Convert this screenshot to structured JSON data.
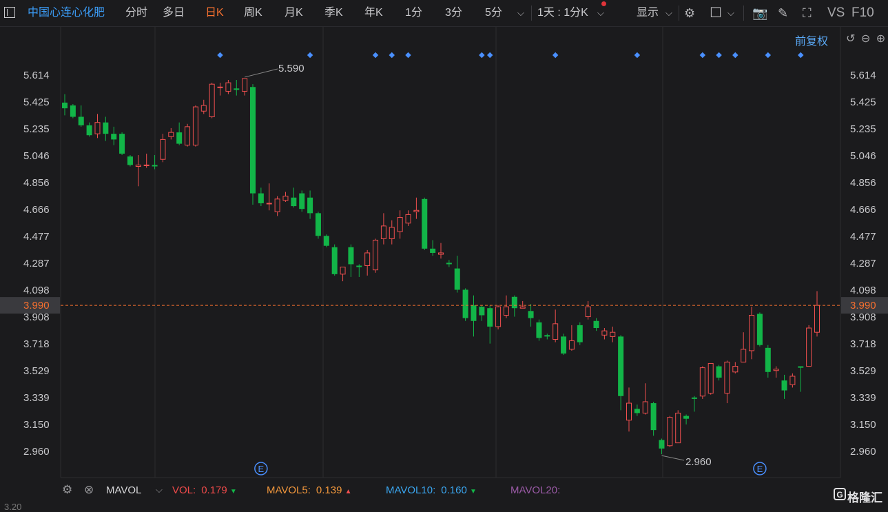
{
  "toolbar": {
    "stock_name": "中国心连心化肥",
    "periods": [
      "分时",
      "多日",
      "日K",
      "周K",
      "月K",
      "季K",
      "年K",
      "1分",
      "3分",
      "5分"
    ],
    "active_period": "日K",
    "interval_select": "1天 : 1分K",
    "display_label": "显示",
    "vs_label": "VS",
    "f10_label": "F10"
  },
  "chart_header": {
    "adjust_label": "前复权"
  },
  "price_axis": {
    "ticks": [
      "5.614",
      "5.425",
      "5.235",
      "5.046",
      "4.856",
      "4.666",
      "4.477",
      "4.287",
      "4.098",
      "3.908",
      "3.718",
      "3.529",
      "3.339",
      "3.150",
      "2.960"
    ],
    "current_price": "3.990",
    "current_price_color": "#f6702f"
  },
  "annotations": {
    "high_label": "5.590",
    "low_label": "2.960",
    "event_marker": "E"
  },
  "indicator": {
    "name": "MAVOL",
    "vol_label": "VOL:",
    "vol_value": "0.179",
    "mavol5_label": "MAVOL5:",
    "mavol5_value": "0.139",
    "mavol10_label": "MAVOL10:",
    "mavol10_value": "0.160",
    "mavol20_label": "MAVOL20:",
    "vol_color": "#ef4a4a",
    "mavol5_color": "#f0963c",
    "mavol10_color": "#3aa6f0",
    "mavol20_color": "#9a5aa6"
  },
  "brand": "格隆汇",
  "bottom_peek": "3.20",
  "colors": {
    "up": "#f04f4f",
    "down": "#12b548",
    "marker": "#4a90ff",
    "grid": "#2c2c30"
  },
  "chart_data": {
    "type": "candlestick",
    "ylim": [
      2.86,
      5.71
    ],
    "candles": [
      [
        5.42,
        5.38,
        5.48,
        5.33
      ],
      [
        5.4,
        5.32,
        5.41,
        5.31
      ],
      [
        5.32,
        5.26,
        5.4,
        5.25
      ],
      [
        5.26,
        5.19,
        5.28,
        5.18
      ],
      [
        5.2,
        5.28,
        5.34,
        5.17
      ],
      [
        5.28,
        5.2,
        5.32,
        5.15
      ],
      [
        5.2,
        5.16,
        5.25,
        5.12
      ],
      [
        5.2,
        5.06,
        5.21,
        5.05
      ],
      [
        5.04,
        4.98,
        5.05,
        4.97
      ],
      [
        4.97,
        4.98,
        5.05,
        4.83
      ],
      [
        4.98,
        4.98,
        5.06,
        4.96
      ],
      [
        4.98,
        4.97,
        5.05,
        4.95
      ],
      [
        5.02,
        5.16,
        5.2,
        5.0
      ],
      [
        5.18,
        5.21,
        5.24,
        5.16
      ],
      [
        5.21,
        5.13,
        5.28,
        5.12
      ],
      [
        5.12,
        5.25,
        5.27,
        5.11
      ],
      [
        5.12,
        5.39,
        5.4,
        5.11
      ],
      [
        5.36,
        5.4,
        5.44,
        5.34
      ],
      [
        5.32,
        5.55,
        5.56,
        5.31
      ],
      [
        5.53,
        5.53,
        5.56,
        5.47
      ],
      [
        5.5,
        5.56,
        5.58,
        5.48
      ],
      [
        5.52,
        5.51,
        5.58,
        5.47
      ],
      [
        5.5,
        5.59,
        5.59,
        5.47
      ],
      [
        5.53,
        4.78,
        5.55,
        4.7
      ],
      [
        4.78,
        4.71,
        4.82,
        4.69
      ],
      [
        4.71,
        4.71,
        4.85,
        4.66
      ],
      [
        4.65,
        4.74,
        4.76,
        4.62
      ],
      [
        4.73,
        4.76,
        4.79,
        4.72
      ],
      [
        4.75,
        4.69,
        4.82,
        4.68
      ],
      [
        4.78,
        4.67,
        4.8,
        4.65
      ],
      [
        4.75,
        4.64,
        4.8,
        4.6
      ],
      [
        4.64,
        4.48,
        4.65,
        4.46
      ],
      [
        4.48,
        4.41,
        4.49,
        4.4
      ],
      [
        4.4,
        4.21,
        4.42,
        4.2
      ],
      [
        4.21,
        4.26,
        4.26,
        4.16
      ],
      [
        4.4,
        4.28,
        4.42,
        4.19
      ],
      [
        4.27,
        4.26,
        4.28,
        4.19
      ],
      [
        4.27,
        4.36,
        4.38,
        4.2
      ],
      [
        4.24,
        4.45,
        4.46,
        4.22
      ],
      [
        4.46,
        4.55,
        4.64,
        4.42
      ],
      [
        4.46,
        4.54,
        4.59,
        4.42
      ],
      [
        4.51,
        4.61,
        4.66,
        4.46
      ],
      [
        4.57,
        4.63,
        4.66,
        4.55
      ],
      [
        4.65,
        4.66,
        4.75,
        4.6
      ],
      [
        4.74,
        4.39,
        4.75,
        4.38
      ],
      [
        4.39,
        4.36,
        4.45,
        4.34
      ],
      [
        4.35,
        4.36,
        4.43,
        4.32
      ],
      [
        4.29,
        4.28,
        4.31,
        4.26
      ],
      [
        4.25,
        4.1,
        4.34,
        4.08
      ],
      [
        4.1,
        3.9,
        4.11,
        3.88
      ],
      [
        3.99,
        3.88,
        4.06,
        3.77
      ],
      [
        3.98,
        3.92,
        3.99,
        3.88
      ],
      [
        3.97,
        3.84,
        3.99,
        3.72
      ],
      [
        3.84,
        3.98,
        3.99,
        3.82
      ],
      [
        3.92,
        3.98,
        4.06,
        3.9
      ],
      [
        4.05,
        3.97,
        4.06,
        3.91
      ],
      [
        3.97,
        3.98,
        4.02,
        3.97
      ],
      [
        3.95,
        3.9,
        4.0,
        3.84
      ],
      [
        3.87,
        3.76,
        3.89,
        3.74
      ],
      [
        3.78,
        3.77,
        3.79,
        3.75
      ],
      [
        3.75,
        3.86,
        3.96,
        3.73
      ],
      [
        3.77,
        3.65,
        3.79,
        3.64
      ],
      [
        3.68,
        3.74,
        3.85,
        3.67
      ],
      [
        3.85,
        3.73,
        3.87,
        3.71
      ],
      [
        3.91,
        3.98,
        4.02,
        3.89
      ],
      [
        3.88,
        3.83,
        3.9,
        3.81
      ],
      [
        3.78,
        3.81,
        3.83,
        3.75
      ],
      [
        3.77,
        3.8,
        3.84,
        3.73
      ],
      [
        3.77,
        3.35,
        3.78,
        3.25
      ],
      [
        3.18,
        3.3,
        3.41,
        3.1
      ],
      [
        3.26,
        3.23,
        3.29,
        3.21
      ],
      [
        3.23,
        3.31,
        3.44,
        3.22
      ],
      [
        3.3,
        3.11,
        3.31,
        3.07
      ],
      [
        3.04,
        2.98,
        3.05,
        2.94
      ],
      [
        3.0,
        3.2,
        3.21,
        2.99
      ],
      [
        3.02,
        3.23,
        3.25,
        3.02
      ],
      [
        3.21,
        3.19,
        3.22,
        3.15
      ],
      [
        3.34,
        3.33,
        3.35,
        3.24
      ],
      [
        3.35,
        3.55,
        3.56,
        3.33
      ],
      [
        3.37,
        3.58,
        3.58,
        3.36
      ],
      [
        3.56,
        3.48,
        3.57,
        3.46
      ],
      [
        3.37,
        3.59,
        3.6,
        3.3
      ],
      [
        3.52,
        3.56,
        3.59,
        3.51
      ],
      [
        3.59,
        3.68,
        3.8,
        3.59
      ],
      [
        3.67,
        3.92,
        3.98,
        3.61
      ],
      [
        3.93,
        3.71,
        3.94,
        3.7
      ],
      [
        3.69,
        3.52,
        3.71,
        3.48
      ],
      [
        3.53,
        3.54,
        3.56,
        3.48
      ],
      [
        3.46,
        3.39,
        3.5,
        3.33
      ],
      [
        3.43,
        3.49,
        3.51,
        3.41
      ],
      [
        3.56,
        3.55,
        3.56,
        3.38
      ],
      [
        3.56,
        3.83,
        3.85,
        3.56
      ],
      [
        3.8,
        3.99,
        4.09,
        3.77
      ]
    ],
    "markers_top": [
      19,
      30,
      38,
      40,
      42,
      51,
      52,
      60,
      70,
      78,
      80,
      82,
      86,
      90
    ],
    "event_markers": [
      24,
      85
    ]
  }
}
